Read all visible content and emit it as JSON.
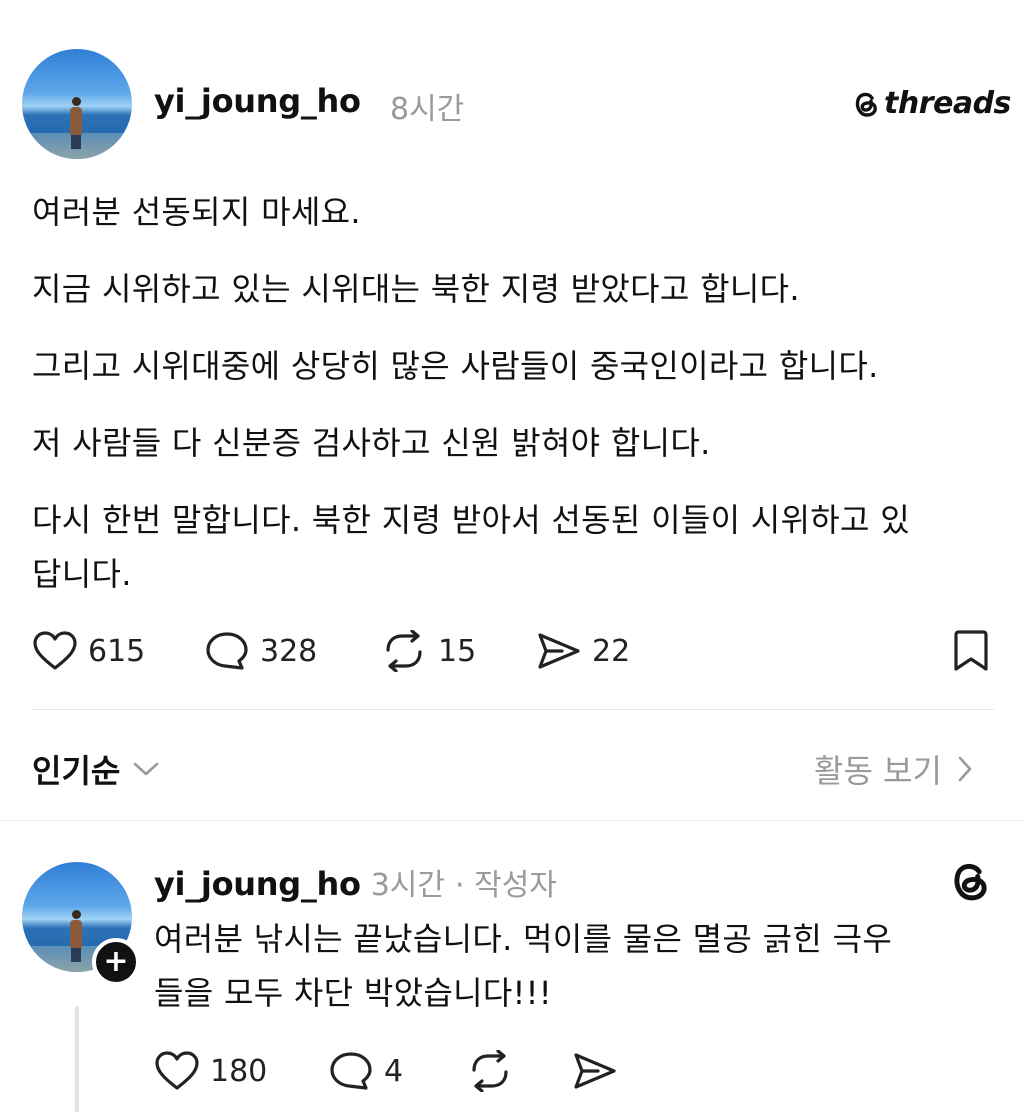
{
  "post": {
    "username": "yi_joung_ho",
    "time": "8시간",
    "brand": "threads",
    "lines": [
      "여러분 선동되지 마세요.",
      "지금 시위하고 있는 시위대는 북한 지령 받았다고 합니다.",
      "그리고 시위대중에 상당히 많은 사람들이 중국인이라고 합니다.",
      "저 사람들 다 신분증 검사하고 신원 밝혀야 합니다.",
      "다시 한번 말합니다. 북한 지령 받아서 선동된 이들이 시위하고 있",
      "답니다."
    ],
    "stats": {
      "likes": "615",
      "comments": "328",
      "reposts": "15",
      "shares": "22"
    }
  },
  "sort_bar": {
    "sort_label": "인기순",
    "activity_label": "활동 보기"
  },
  "reply": {
    "username": "yi_joung_ho",
    "time": "3시간",
    "author_tag": "· 작성자",
    "lines": [
      "여러분 낚시는 끝났습니다. 먹이를 물은 멸공 긁힌 극우",
      "들을 모두 차단 박았습니다!!!"
    ],
    "stats": {
      "likes": "180",
      "comments": "4"
    },
    "follow_badge": "+"
  },
  "icons": {
    "like": "heart-icon",
    "comment": "comment-bubble-icon",
    "repost": "repost-icon",
    "share": "send-icon",
    "save": "bookmark-icon",
    "sort": "chevron-down-icon",
    "activity": "chevron-right-icon",
    "threads": "threads-logo-icon"
  }
}
